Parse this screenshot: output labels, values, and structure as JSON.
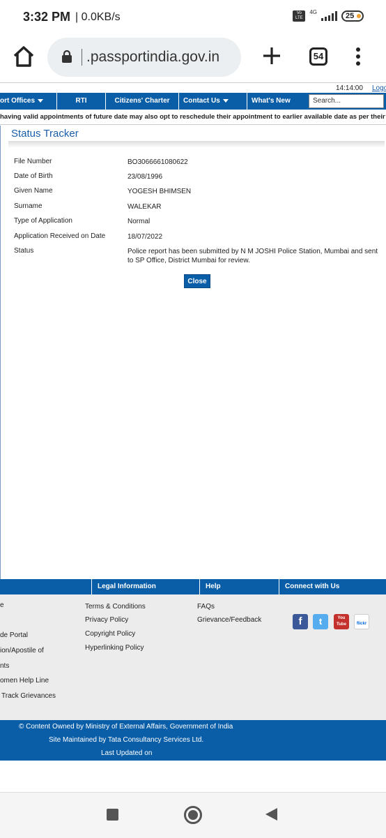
{
  "status_bar": {
    "time": "3:32 PM",
    "speed": "| 0.0KB/s",
    "volte": "Vo LTE",
    "network": "4G",
    "battery": "25"
  },
  "browser": {
    "url": ".passportindia.gov.in",
    "tab_count": "54"
  },
  "site": {
    "time": "14:14:00",
    "top_link": "Logo",
    "nav": [
      {
        "label": "ort Offices",
        "dropdown": true
      },
      {
        "label": "RTI",
        "dropdown": false
      },
      {
        "label": "Citizens' Charter",
        "dropdown": false
      },
      {
        "label": "Contact Us",
        "dropdown": true
      },
      {
        "label": "What's New",
        "dropdown": false
      }
    ],
    "search_placeholder": "Search...",
    "ticker": "having valid appointments of future date may also opt to reschedule their appointment to earlier available date as per their conveni"
  },
  "tracker": {
    "title": "Status Tracker",
    "rows": [
      {
        "label": "File Number",
        "value": "BO3066661080622"
      },
      {
        "label": "Date of Birth",
        "value": "23/08/1996"
      },
      {
        "label": "Given Name",
        "value": "YOGESH BHIMSEN"
      },
      {
        "label": "Surname",
        "value": "WALEKAR"
      },
      {
        "label": "Type of Application",
        "value": "Normal"
      },
      {
        "label": "Application Received on Date",
        "value": "18/07/2022"
      },
      {
        "label": "Status",
        "value": "Police report has been submitted by N M JOSHI Police Station, Mumbai and sent to SP Office, District Mumbai for review."
      }
    ],
    "close_label": "Close"
  },
  "footer": {
    "headers": [
      "Legal Information",
      "Help",
      "Connect with Us"
    ],
    "col1": [
      "e",
      "de Portal",
      "ion/Apostile of",
      "nts",
      "omen Help Line",
      "Track Grievances"
    ],
    "legal": [
      "Terms & Conditions",
      "Privacy Policy",
      "Copyright Policy",
      "Hyperlinking Policy"
    ],
    "help": [
      "FAQs",
      "Grievance/Feedback"
    ],
    "social_labels": [
      "f",
      "t",
      "You Tube",
      "flickr"
    ],
    "social_colors": [
      "#3b5998",
      "#55acee",
      "#c4302b",
      "#ffffff"
    ],
    "bottom": [
      "© Content Owned by Ministry of External Affairs, Government of India",
      "Site Maintained by Tata Consultancy Services Ltd.",
      "Last Updated on"
    ]
  }
}
